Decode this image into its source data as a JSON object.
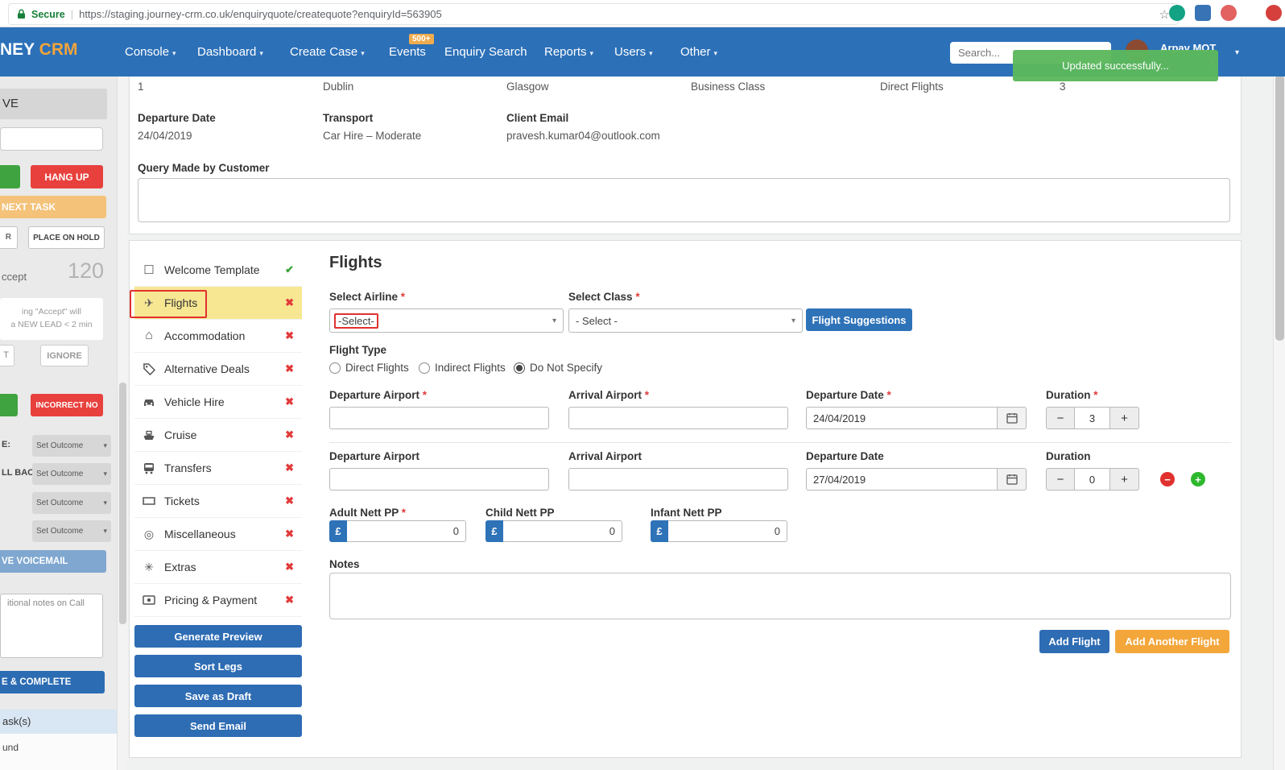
{
  "browser": {
    "secure_label": "Secure",
    "separator": "|",
    "url": "https://staging.journey-crm.co.uk/enquiryquote/createquote?enquiryId=563905"
  },
  "icons": {
    "star": "☆",
    "caret": "▾",
    "chevron": "▾",
    "check": "✔",
    "cross": "✖",
    "welcome": "☐",
    "plane": "✈",
    "home": "⌂",
    "misc": "◎",
    "extras": "✳",
    "minus": "−",
    "plus": "+"
  },
  "navbar": {
    "brand_clip": "NEY",
    "brand_accent": " CRM",
    "menu": [
      {
        "label": "Console"
      },
      {
        "label": "Dashboard"
      },
      {
        "label": "Create Case"
      },
      {
        "label": "Events"
      },
      {
        "label": "Enquiry Search"
      },
      {
        "label": "Reports"
      },
      {
        "label": "Users"
      },
      {
        "label": "Other"
      }
    ],
    "events_badge": "500+",
    "search_placeholder": "Search...",
    "user_name": "Arpav MOT",
    "user_fragment": "t"
  },
  "toast": {
    "message": "Updated successfully..."
  },
  "sidebar": {
    "header_fragment": "VE",
    "hang_up": "HANG UP",
    "next_task": "NEXT TASK",
    "hold_fragment": "R",
    "place_on_hold": "PLACE ON HOLD",
    "accept_fragment": "ccept",
    "timer": "120",
    "accept_note_line1": "ing \"Accept\" will",
    "accept_note_line2": "a NEW LEAD < 2 min",
    "ignore_fragment": "T",
    "ignore": "IGNORE",
    "incorrect_no": "INCORRECT NO",
    "outcome_label_1": "E:",
    "outcome_label_2": "LL BACK:",
    "set_outcome": "Set Outcome",
    "voicemail": "VE VOICEMAIL",
    "notes_fragment": "itional notes on Call",
    "complete": "E & COMPLETE",
    "tasks_fragment": "ask(s)",
    "bottom_fragment": "und"
  },
  "enquiry": {
    "summary": [
      "1",
      "Dublin",
      "Glasgow",
      "Business Class",
      "Direct Flights",
      "3"
    ],
    "departure_date_label": "Departure Date",
    "departure_date": "24/04/2019",
    "transport_label": "Transport",
    "transport": "Car Hire – Moderate",
    "client_email_label": "Client Email",
    "client_email": "pravesh.kumar04@outlook.com",
    "query_label": "Query Made by Customer"
  },
  "quote_tabs": {
    "items": [
      {
        "label": "Welcome Template"
      },
      {
        "label": "Flights"
      },
      {
        "label": "Accommodation"
      },
      {
        "label": "Alternative Deals"
      },
      {
        "label": "Vehicle Hire"
      },
      {
        "label": "Cruise"
      },
      {
        "label": "Transfers"
      },
      {
        "label": "Tickets"
      },
      {
        "label": "Miscellaneous"
      },
      {
        "label": "Extras"
      },
      {
        "label": "Pricing & Payment"
      }
    ],
    "actions": [
      {
        "label": "Generate Preview"
      },
      {
        "label": "Sort Legs"
      },
      {
        "label": "Save as Draft"
      },
      {
        "label": "Send Email"
      }
    ]
  },
  "flights": {
    "title": "Flights",
    "airline_label": "Select Airline",
    "airline_value": "-Select-",
    "class_label": "Select Class",
    "class_value": "- Select -",
    "suggestions_button": "Flight Suggestions",
    "flight_type_label": "Flight Type",
    "flight_type_options": [
      {
        "label": "Direct Flights"
      },
      {
        "label": "Indirect Flights"
      },
      {
        "label": "Do Not Specify"
      }
    ],
    "leg1": {
      "dep_label": "Departure Airport",
      "arr_label": "Arrival Airport",
      "date_label": "Departure Date",
      "duration_label": "Duration",
      "date": "24/04/2019",
      "duration": "3"
    },
    "leg2": {
      "dep_label": "Departure Airport",
      "arr_label": "Arrival Airport",
      "date_label": "Departure Date",
      "duration_label": "Duration",
      "date": "27/04/2019",
      "duration": "0"
    },
    "nett": [
      {
        "label": "Adult Nett PP",
        "currency": "£",
        "value": "0"
      },
      {
        "label": "Child Nett PP",
        "currency": "£",
        "value": "0"
      },
      {
        "label": "Infant Nett PP",
        "currency": "£",
        "value": "0"
      }
    ],
    "notes_label": "Notes",
    "add_flight": "Add Flight",
    "add_another_flight": "Add Another Flight"
  }
}
